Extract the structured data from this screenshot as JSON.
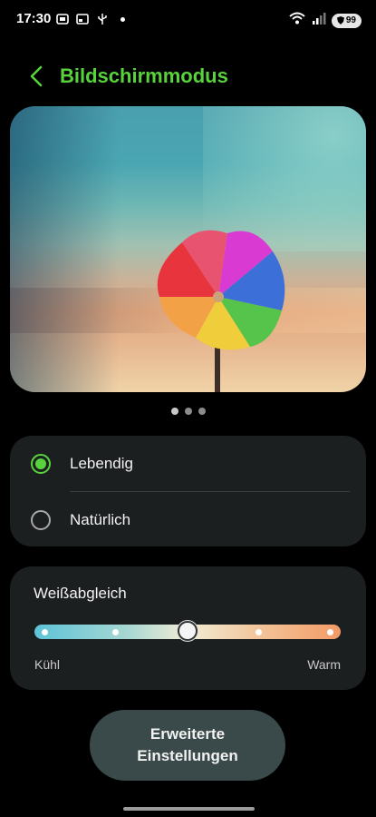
{
  "status_bar": {
    "time": "17:30",
    "battery": "99",
    "icons": [
      "screenshot-icon",
      "cast-icon",
      "usb-icon",
      "dot-icon",
      "wifi-icon",
      "signal-icon",
      "battery-icon"
    ]
  },
  "header": {
    "title": "Bildschirmmodus",
    "accent_color": "#58d33b"
  },
  "preview": {
    "pages": 3,
    "active_page": 0
  },
  "modes": {
    "selected": "Lebendig",
    "options": [
      {
        "label": "Lebendig",
        "checked": true
      },
      {
        "label": "Natürlich",
        "checked": false
      }
    ]
  },
  "white_balance": {
    "title": "Weißabgleich",
    "low_label": "Kühl",
    "high_label": "Warm",
    "steps": 5,
    "value_step": 3
  },
  "advanced_button": {
    "label": "Erweiterte\nEinstellungen"
  }
}
